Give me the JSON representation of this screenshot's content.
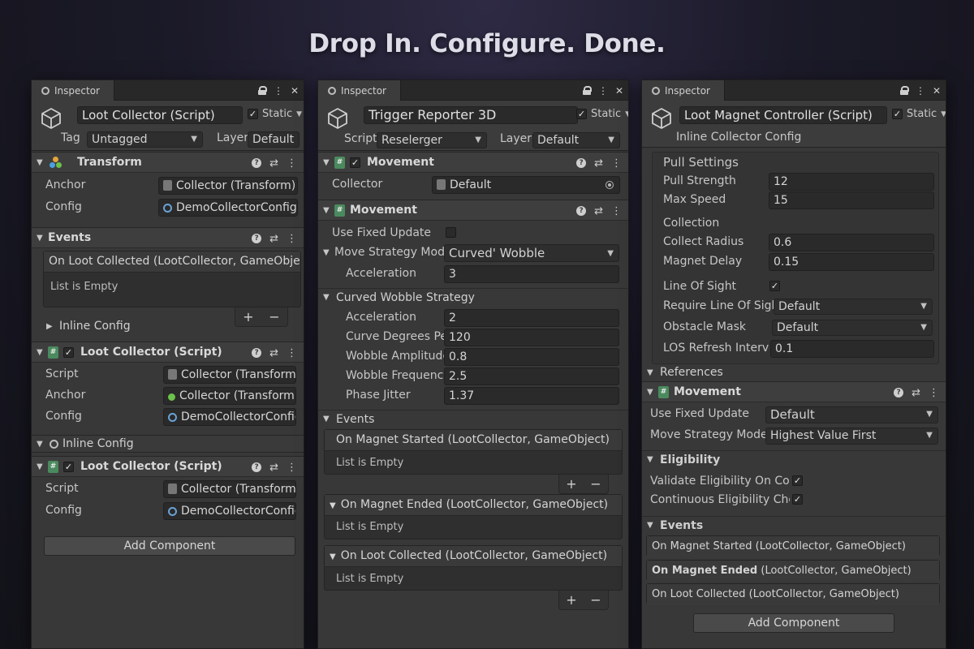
{
  "headline": "Drop In. Configure. Done.",
  "inspector_tab": "Inspector",
  "static_label": "Static",
  "colors": {
    "accent_green": "#4a8a5e",
    "config_blue": "#6aa2d6",
    "panel_bg": "#383838"
  },
  "p1": {
    "name": "Loot Collector (Script)",
    "tag_label": "Tag",
    "tag_value": "Untagged",
    "layer_label": "Layer",
    "layer_value": "Default",
    "transform": {
      "title": "Transform",
      "anchor_label": "Anchor",
      "anchor_value": "Collector (Transform)",
      "config_label": "Config",
      "config_value": "DemoCollectorConfig"
    },
    "events": {
      "title": "Events",
      "event_title": "On Loot Collected (LootCollector, GameObject)",
      "empty": "List is Empty",
      "inline_config": "Inline Config"
    },
    "comp1": {
      "title": "Loot Collector (Script)",
      "script_label": "Script",
      "script_value": "Collector (Transform)",
      "anchor_label": "Anchor",
      "anchor_value": "Collector (Transform)",
      "config_label": "Config",
      "config_value": "DemoCollectorConfig ("
    },
    "inline_config": "Inline Config",
    "comp2": {
      "title": "Loot Collector (Script)",
      "script_label": "Script",
      "script_value": "Collector (Transform)",
      "config_label": "Config",
      "config_value": "DemoCollectorConfig ("
    },
    "add_component": "Add Component"
  },
  "p2": {
    "name": "Trigger Reporter 3D",
    "script_label": "Script",
    "script_value": "Reselerger",
    "layer_label": "Layer",
    "layer_value": "Default",
    "movement1": {
      "title": "Movement",
      "collector_label": "Collector",
      "collector_value": "Default"
    },
    "movement2": {
      "title": "Movement",
      "use_fixed_label": "Use Fixed Update",
      "move_strategy_label": "Move Strategy Mode",
      "move_strategy_value": "Curved' Wobble",
      "accel_label": "Acceleration",
      "accel_value": "3"
    },
    "curved": {
      "title": "Curved Wobble Strategy",
      "accel_label": "Acceleration",
      "accel_value": "2",
      "curve_label": "Curve Degrees Per",
      "curve_value": "120",
      "amp_label": "Wobble Amplitude",
      "amp_value": "0.8",
      "freq_label": "Wobble Frequency",
      "freq_value": "2.5",
      "jitter_label": "Phase Jitter",
      "jitter_value": "1.37"
    },
    "events": {
      "title": "Events",
      "e1_title": "On Magnet Started  (LootCollector, GameObject)",
      "e2_title": "On Magnet Ended  (LootCollector, GameObject)",
      "e3_title": "On Loot Collected (LootCollector, GameObject)",
      "empty": "List is Empty"
    }
  },
  "p3": {
    "name": "Loot Magnet Controller (Script)",
    "inline_label": "Inline Collector Config",
    "pull": {
      "title": "Pull Settings",
      "strength_label": "Pull Strength",
      "strength_value": "12",
      "speed_label": "Max Speed",
      "speed_value": "15"
    },
    "collection": {
      "title": "Collection",
      "radius_label": "Collect Radius",
      "radius_value": "0.6",
      "delay_label": "Magnet Delay",
      "delay_value": "0.15"
    },
    "los": {
      "los_label": "Line Of Sight",
      "require_label": "Require Line Of Sight",
      "require_value": "Default",
      "mask_label": "Obstacle Mask",
      "mask_value": "Default",
      "refresh_label": "LOS Refresh Interval",
      "refresh_value": "0.1"
    },
    "references": "References",
    "movement": {
      "title": "Movement",
      "use_fixed_label": "Use Fixed Update",
      "use_fixed_value": "Default",
      "move_label": "Move Strategy Mode",
      "move_value": "Highest Value First"
    },
    "eligibility": {
      "title": "Eligibility",
      "validate_label": "Validate Eligibility On Colle",
      "continuous_label": "Continuous Eligibility Chec"
    },
    "events": {
      "title": "Events",
      "e1_event": "On Magnet Started",
      "e1_args": "(LootCollector, GameObject)",
      "e2_event": "On Magnet Ended",
      "e2_args": "(LootCollector, GameObject)",
      "e3_title": "On Loot Collected (LootCollector, GameObject)"
    },
    "add_component": "Add Component"
  }
}
